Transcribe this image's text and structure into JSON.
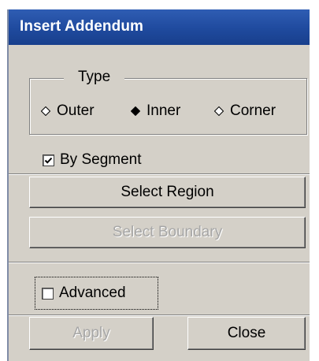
{
  "window": {
    "title": "Insert Addendum"
  },
  "type_group": {
    "legend": "Type",
    "options": [
      {
        "label": "Outer",
        "selected": false
      },
      {
        "label": "Inner",
        "selected": true
      },
      {
        "label": "Corner",
        "selected": false
      }
    ]
  },
  "by_segment": {
    "label": "By Segment",
    "checked": true
  },
  "buttons": {
    "select_region": "Select Region",
    "select_boundary": "Select Boundary",
    "apply": "Apply",
    "close": "Close"
  },
  "advanced": {
    "label": "Advanced",
    "checked": false
  },
  "colors": {
    "titlebar": "#1f4a9e",
    "dialog_bg": "#d4d0c8",
    "disabled_text": "#a6a6a6"
  }
}
